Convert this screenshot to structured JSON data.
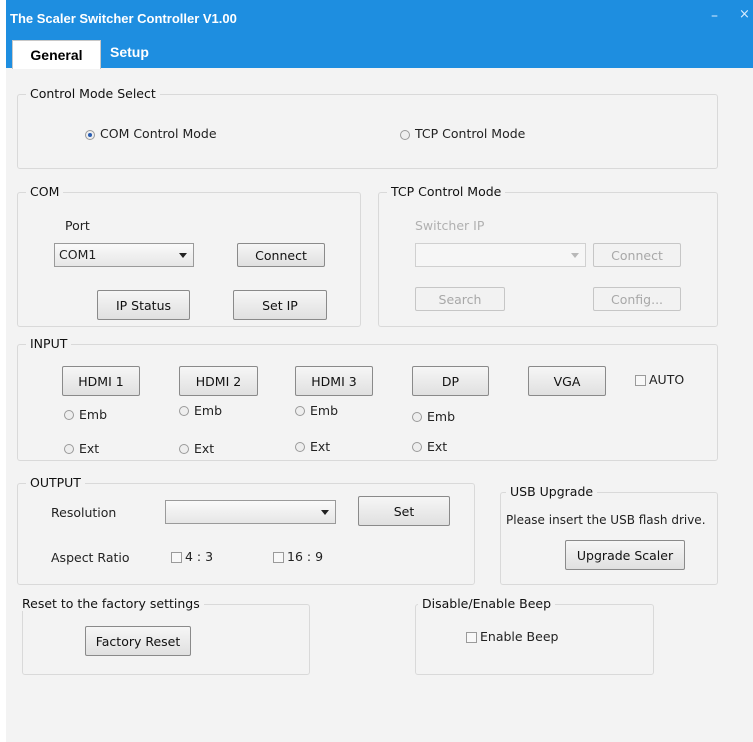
{
  "window": {
    "title": "The Scaler Switcher Controller  V1.00",
    "minimize_glyph": "–",
    "close_glyph": "×"
  },
  "tabs": [
    {
      "label": "General"
    },
    {
      "label": "Setup"
    }
  ],
  "control_mode": {
    "group_label": "Control Mode Select",
    "com_label": "COM Control Mode",
    "tcp_label": "TCP Control Mode",
    "selected": "COM Control Mode"
  },
  "com": {
    "group_label": "COM",
    "port_label": "Port",
    "port_value": "COM1",
    "connect_label": "Connect",
    "ip_status_label": "IP  Status",
    "set_ip_label": "Set  IP"
  },
  "tcp": {
    "group_label": "TCP Control Mode",
    "switcher_ip_label": "Switcher IP",
    "ip_value": "",
    "connect_label": "Connect",
    "search_label": "Search",
    "config_label": "Config..."
  },
  "input": {
    "group_label": "INPUT",
    "sources": [
      {
        "label": "HDMI 1",
        "emb": "Emb",
        "ext": "Ext"
      },
      {
        "label": "HDMI 2",
        "emb": "Emb",
        "ext": "Ext"
      },
      {
        "label": "HDMI 3",
        "emb": "Emb",
        "ext": "Ext"
      },
      {
        "label": "DP",
        "emb": "Emb",
        "ext": "Ext"
      },
      {
        "label": "VGA"
      }
    ],
    "auto_label": "AUTO"
  },
  "output": {
    "group_label": "OUTPUT",
    "resolution_label": "Resolution",
    "resolution_value": "",
    "set_label": "Set",
    "aspect_label": "Aspect Ratio",
    "aspect_4_3": "4 : 3",
    "aspect_16_9": "16 : 9"
  },
  "usb": {
    "group_label": "USB Upgrade",
    "message": "Please insert the USB flash drive.",
    "upgrade_label": "Upgrade Scaler"
  },
  "factory": {
    "group_label": "Reset to the factory settings",
    "button_label": "Factory Reset"
  },
  "beep": {
    "group_label": "Disable/Enable Beep",
    "checkbox_label": "Enable Beep"
  },
  "colors": {
    "titlebar": "#1e8ee0",
    "window_bg": "#f3f3f3",
    "radio_selected": "#2a5db0"
  }
}
